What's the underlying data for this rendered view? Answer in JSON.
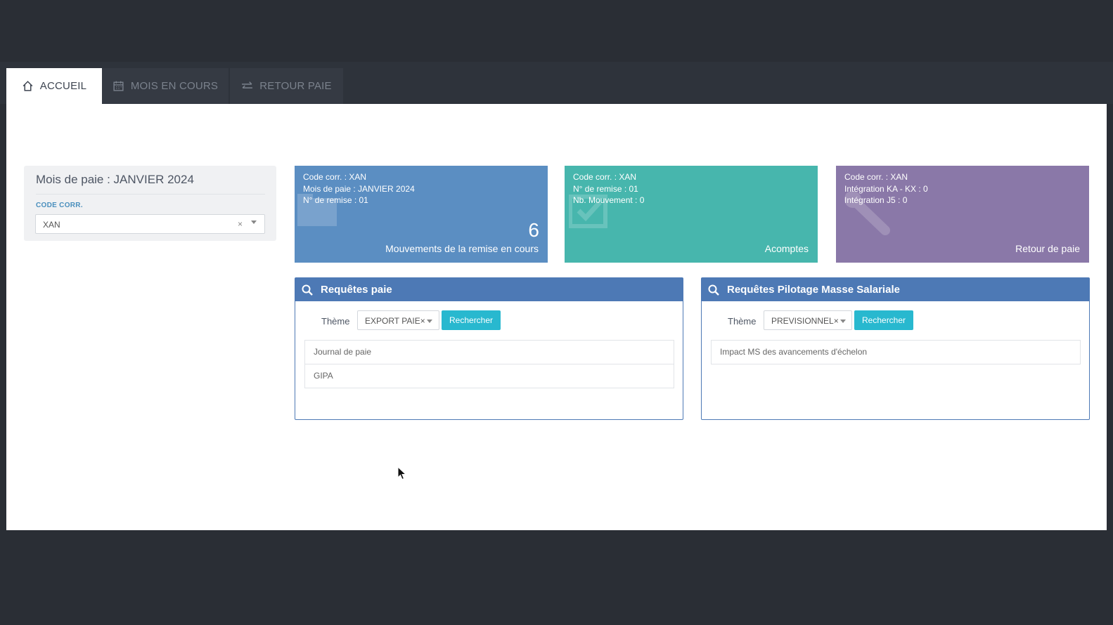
{
  "tabs": [
    {
      "label": "ACCUEIL",
      "icon": "home-icon",
      "active": true
    },
    {
      "label": "MOIS EN COURS",
      "icon": "calendar-icon",
      "active": false
    },
    {
      "label": "RETOUR PAIE",
      "icon": "exchange-icon",
      "active": false
    }
  ],
  "month_panel": {
    "title": "Mois de paie : JANVIER 2024",
    "code_label": "CODE CORR.",
    "code_value": "XAN",
    "clear_glyph": "×"
  },
  "cards": [
    {
      "lines": [
        "Code corr. : XAN",
        "Mois de paie : JANVIER 2024",
        "N° de remise : 01"
      ],
      "count": "6",
      "caption": "Mouvements de la remise en cours",
      "color": "#5b8ec2"
    },
    {
      "lines": [
        "Code corr. : XAN",
        "N° de remise : 01",
        "Nb. Mouvement : 0"
      ],
      "caption": "Acomptes",
      "color": "#47b6ad"
    },
    {
      "lines": [
        "Code corr. : XAN",
        "Intégration KA - KX : 0",
        "Intégration J5 : 0"
      ],
      "caption": "Retour de paie",
      "color": "#8a78a8"
    }
  ],
  "requetes_paie": {
    "title": "Requêtes paie",
    "theme_label": "Thème",
    "theme_value": "EXPORT PAIE×",
    "button": "Rechercher",
    "results": [
      "Journal de paie",
      "GIPA"
    ]
  },
  "requetes_pilotage": {
    "title": "Requêtes Pilotage Masse Salariale",
    "theme_label": "Thème",
    "theme_value": "PREVISIONNEL×",
    "button": "Rechercher",
    "results": [
      "Impact MS des avancements d'échelon"
    ]
  },
  "colors": {
    "header_blue": "#4d79b5",
    "button_cyan": "#28b8cf",
    "background_dark": "#2a2e35"
  }
}
